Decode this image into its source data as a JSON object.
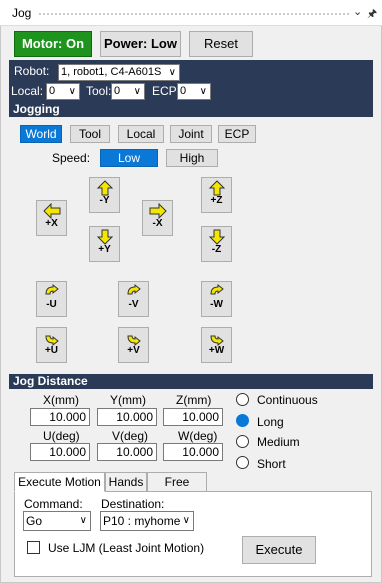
{
  "window": {
    "title": "Jog",
    "icons": [
      "chevron-down-icon",
      "pin-icon"
    ]
  },
  "top": {
    "motor": "Motor: On",
    "power": "Power: Low",
    "reset": "Reset"
  },
  "robot": {
    "label": "Robot:",
    "value": "1, robot1, C4-A601S"
  },
  "local": {
    "label": "Local:",
    "value": "0"
  },
  "tool": {
    "label": "Tool:",
    "value": "0"
  },
  "ecp": {
    "label": "ECP:",
    "value": "0"
  },
  "jogging": {
    "header": "Jogging",
    "modes": [
      "World",
      "Tool",
      "Local",
      "Joint",
      "ECP"
    ],
    "selected_mode": "World",
    "speed_label": "Speed:",
    "speed_low": "Low",
    "speed_high": "High",
    "selected_speed": "Low",
    "buttons": {
      "ny": "-Y",
      "px": "+X",
      "nx": "-X",
      "py": "+Y",
      "pz": "+Z",
      "nz": "-Z",
      "nu": "-U",
      "nv": "-V",
      "nw": "-W",
      "pu": "+U",
      "pv": "+V",
      "pw": "+W"
    }
  },
  "distance": {
    "header": "Jog Distance",
    "x_label": "X(mm)",
    "y_label": "Y(mm)",
    "z_label": "Z(mm)",
    "u_label": "U(deg)",
    "v_label": "V(deg)",
    "w_label": "W(deg)",
    "x": "10.000",
    "y": "10.000",
    "z": "10.000",
    "u": "10.000",
    "v": "10.000",
    "w": "10.000",
    "options": [
      "Continuous",
      "Long",
      "Medium",
      "Short"
    ],
    "selected": "Long"
  },
  "bottom_tabs": [
    "Execute Motion",
    "Hands",
    "Free Joints"
  ],
  "execute": {
    "command_label": "Command:",
    "command_value": "Go",
    "destination_label": "Destination:",
    "destination_value": "P10 : myhome",
    "ljm_label": "Use LJM (Least Joint Motion)",
    "ljm_checked": false,
    "execute_label": "Execute"
  },
  "colors": {
    "accent": "#0a78d7",
    "motor_on": "#1e941e",
    "header": "#2b3a57",
    "arrow": "#f3e600"
  }
}
